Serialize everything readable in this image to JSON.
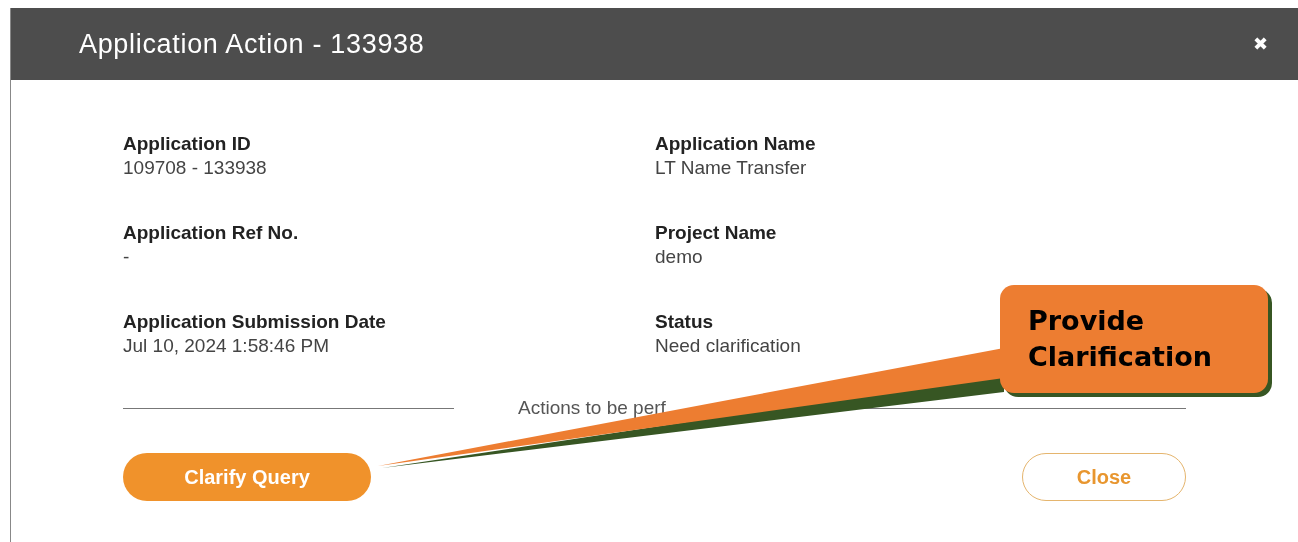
{
  "dialog": {
    "title": "Application Action - 133938",
    "close_icon": "✖",
    "fields": [
      {
        "label": "Application ID",
        "value": "109708 - 133938"
      },
      {
        "label": "Application Name",
        "value": "LT Name Transfer"
      },
      {
        "label": "Application Ref No.",
        "value": "-"
      },
      {
        "label": "Project Name",
        "value": "demo"
      },
      {
        "label": "Application Submission Date",
        "value": "Jul 10, 2024 1:58:46 PM"
      },
      {
        "label": "Status",
        "value": "Need clarification"
      }
    ],
    "section_heading": "Actions to be perf",
    "buttons": [
      {
        "label": "Clarify Query",
        "kind": "primary"
      },
      {
        "label": "Close",
        "kind": "outline"
      }
    ]
  },
  "callout": {
    "text": "Provide Clarification"
  }
}
